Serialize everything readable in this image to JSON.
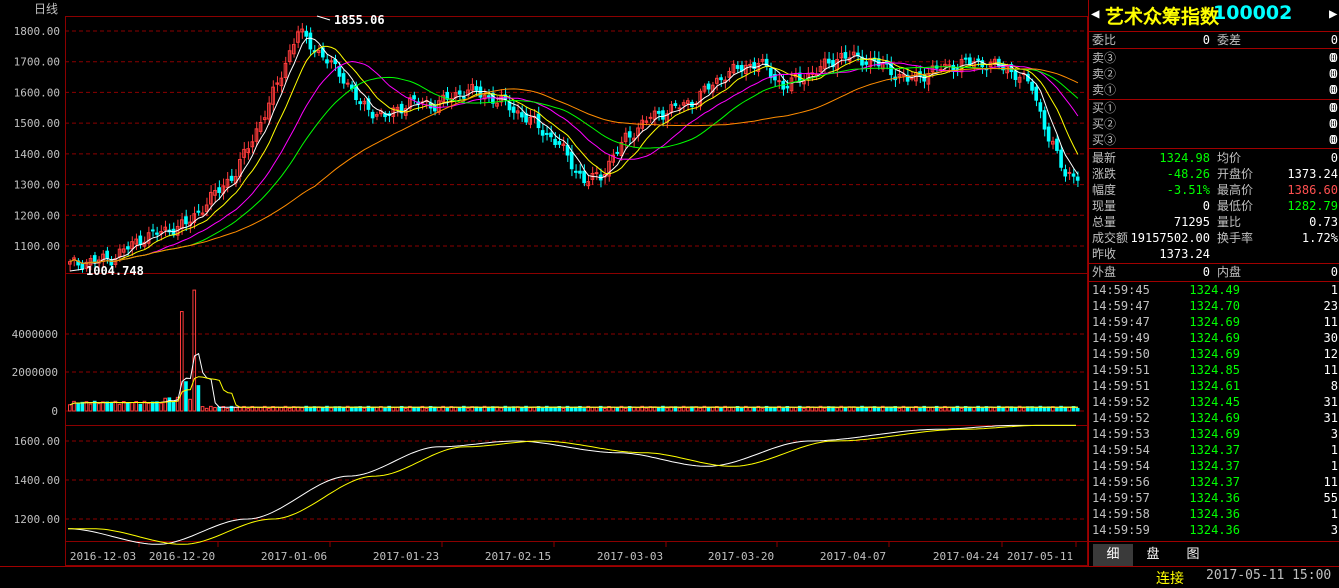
{
  "chart": {
    "period_label": "日线",
    "high_label": "1855.06",
    "low_label": "1004.748",
    "price_axis": [
      "1800.00",
      "1700.00",
      "1600.00",
      "1500.00",
      "1400.00",
      "1300.00",
      "1200.00",
      "1100.00"
    ],
    "volume_axis": [
      "4000000",
      "2000000",
      "0"
    ],
    "indicator_axis": [
      "1600.00",
      "1400.00",
      "1200.00"
    ],
    "date_axis": [
      "2016-12-03",
      "2016-12-20",
      "2017-01-06",
      "2017-01-23",
      "2017-02-15",
      "2017-03-03",
      "2017-03-20",
      "2017-04-07",
      "2017-04-24",
      "2017-05-11"
    ],
    "colors": {
      "up": "#ff3c3c",
      "down": "#00ffff",
      "grid": "#8b0000",
      "ma5": "#ffffff",
      "ma10": "#ffff00",
      "ma20": "#ff00ff",
      "ma30": "#00ff00",
      "ma60": "#ff8c00"
    }
  },
  "chart_data": {
    "type": "candlestick",
    "title": "",
    "x": [
      "2016-12-03",
      "2016-12-20",
      "2017-01-06",
      "2017-01-23",
      "2017-02-15",
      "2017-03-03",
      "2017-03-20",
      "2017-04-07",
      "2017-04-24",
      "2017-05-11"
    ],
    "close_trend": [
      1045,
      1130,
      1800,
      1540,
      1600,
      1330,
      1570,
      1690,
      1700,
      1325
    ],
    "ylim": [
      1000,
      1860
    ]
  },
  "panel": {
    "title": "艺术众筹指数",
    "code": "100002",
    "wb_label": "委比",
    "wb_value": "0",
    "wc_label": "委差",
    "wc_value": "0",
    "sells": [
      {
        "label": "卖③",
        "price": "0",
        "vol": "0"
      },
      {
        "label": "卖②",
        "price": "0",
        "vol": "0"
      },
      {
        "label": "卖①",
        "price": "0",
        "vol": "0"
      }
    ],
    "buys": [
      {
        "label": "买①",
        "price": "0",
        "vol": "0"
      },
      {
        "label": "买②",
        "price": "0",
        "vol": "0"
      },
      {
        "label": "买③",
        "price": "0",
        "vol": "0"
      }
    ],
    "stats": [
      {
        "l1": "最新",
        "v1": "1324.98",
        "c1": "g",
        "l2": "均价",
        "v2": "0",
        "c2": "w"
      },
      {
        "l1": "涨跌",
        "v1": "-48.26",
        "c1": "g",
        "l2": "开盘价",
        "v2": "1373.24",
        "c2": "w"
      },
      {
        "l1": "幅度",
        "v1": "-3.51%",
        "c1": "g",
        "l2": "最高价",
        "v2": "1386.60",
        "c2": "r"
      },
      {
        "l1": "现量",
        "v1": "0",
        "c1": "w",
        "l2": "最低价",
        "v2": "1282.79",
        "c2": "g"
      },
      {
        "l1": "总量",
        "v1": "71295",
        "c1": "w",
        "l2": "量比",
        "v2": "0.73",
        "c2": "w"
      },
      {
        "l1": "成交额",
        "v1": "19157502.00",
        "c1": "w",
        "l2": "换手率",
        "v2": "1.72%",
        "c2": "w"
      }
    ],
    "prev_close_label": "昨收",
    "prev_close": "1373.24",
    "outer_label": "外盘",
    "outer": "0",
    "inner_label": "内盘",
    "inner": "0",
    "ticks": [
      {
        "t": "14:59:45",
        "p": "1324.49",
        "v": "1"
      },
      {
        "t": "14:59:47",
        "p": "1324.70",
        "v": "23"
      },
      {
        "t": "14:59:47",
        "p": "1324.69",
        "v": "11"
      },
      {
        "t": "14:59:49",
        "p": "1324.69",
        "v": "30"
      },
      {
        "t": "14:59:50",
        "p": "1324.69",
        "v": "12"
      },
      {
        "t": "14:59:51",
        "p": "1324.85",
        "v": "11"
      },
      {
        "t": "14:59:51",
        "p": "1324.61",
        "v": "8"
      },
      {
        "t": "14:59:52",
        "p": "1324.45",
        "v": "31"
      },
      {
        "t": "14:59:52",
        "p": "1324.69",
        "v": "31"
      },
      {
        "t": "14:59:53",
        "p": "1324.69",
        "v": "3"
      },
      {
        "t": "14:59:54",
        "p": "1324.37",
        "v": "1"
      },
      {
        "t": "14:59:54",
        "p": "1324.37",
        "v": "1"
      },
      {
        "t": "14:59:56",
        "p": "1324.37",
        "v": "11"
      },
      {
        "t": "14:59:57",
        "p": "1324.36",
        "v": "55"
      },
      {
        "t": "14:59:58",
        "p": "1324.36",
        "v": "1"
      },
      {
        "t": "14:59:59",
        "p": "1324.36",
        "v": "3"
      }
    ],
    "tabs": [
      "细",
      "盘",
      "图"
    ]
  },
  "status": {
    "connection": "连接",
    "datetime": "2017-05-11 15:00"
  }
}
